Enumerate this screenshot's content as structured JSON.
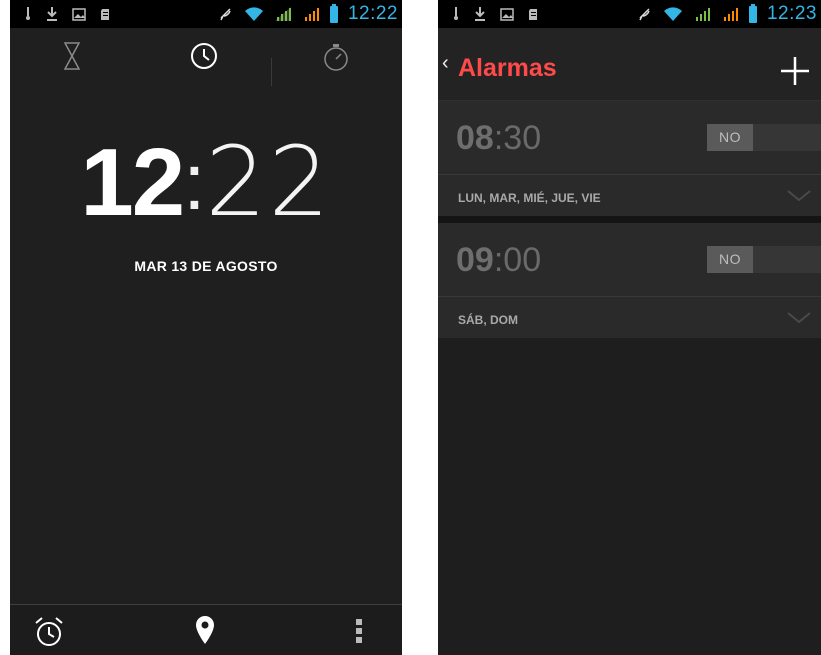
{
  "clock_screen": {
    "status_bar": {
      "time": "12:22"
    },
    "tabs": [
      {
        "name": "timer",
        "icon": "hourglass-icon"
      },
      {
        "name": "clock",
        "icon": "clock-icon",
        "active": true
      },
      {
        "name": "stopwatch",
        "icon": "stopwatch-icon"
      }
    ],
    "clock": {
      "hours": "12",
      "separator": ":",
      "minutes": "22"
    },
    "date": "MAR 13 DE AGOSTO",
    "bottom_bar": [
      "alarm-clock-icon",
      "location-pin-icon",
      "overflow-menu-icon"
    ]
  },
  "alarms_screen": {
    "status_bar": {
      "time": "12:23"
    },
    "action_bar": {
      "back_glyph": "‹",
      "title": "Alarmas",
      "add_icon": "plus-icon"
    },
    "alarms": [
      {
        "hours": "08",
        "separator": ":",
        "minutes": "30",
        "toggle_label": "NO",
        "days": "LUN, MAR, MIÉ, JUE, VIE"
      },
      {
        "hours": "09",
        "separator": ":",
        "minutes": "00",
        "toggle_label": "NO",
        "days": "SÁB, DOM"
      }
    ]
  },
  "colors": {
    "status_accent": "#33b5e5",
    "title_red": "#ff4a4a",
    "background": "#1f1f1f",
    "signal_orange": "#ff8a00"
  }
}
